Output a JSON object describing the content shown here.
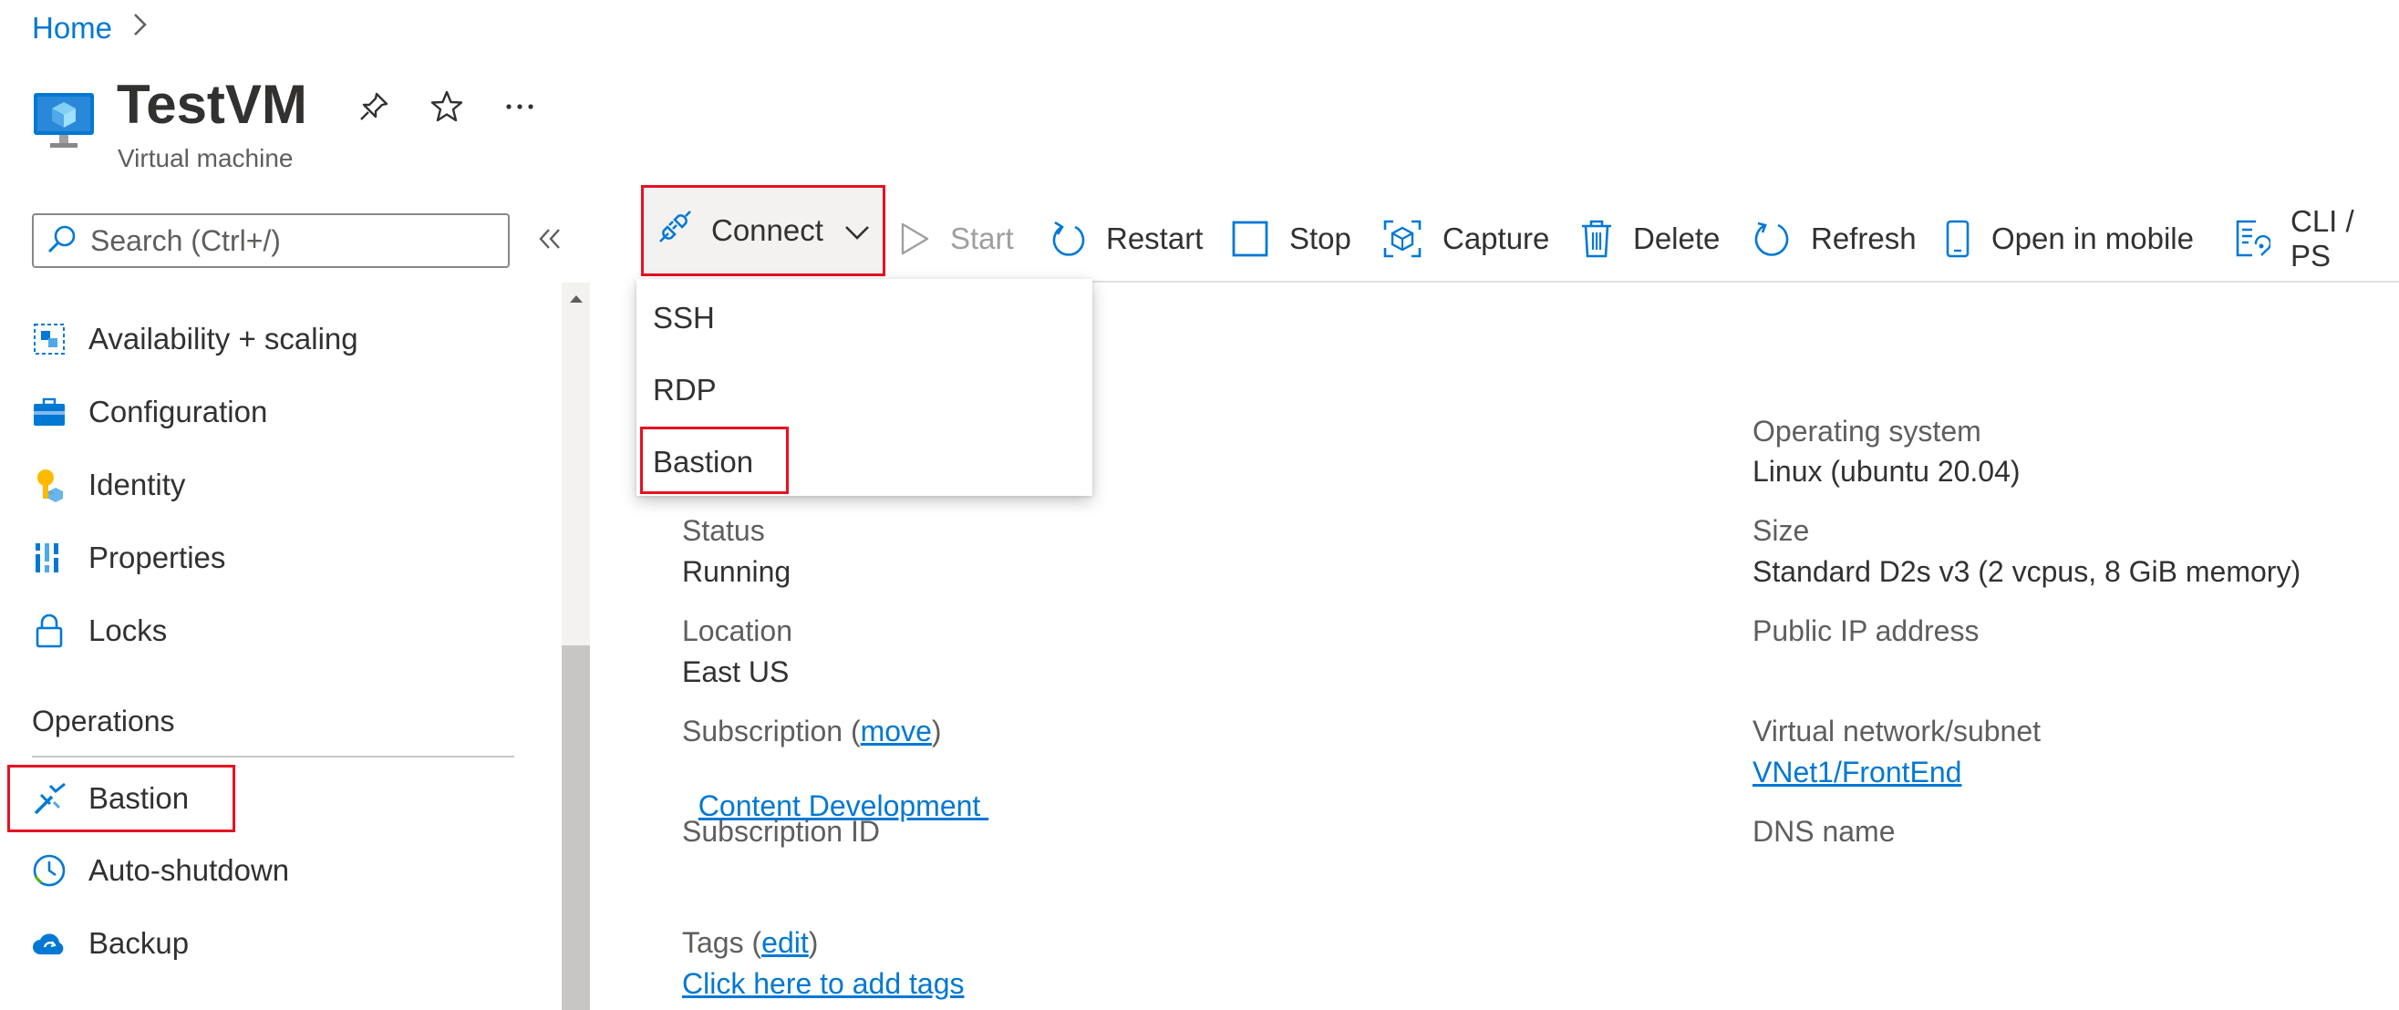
{
  "breadcrumb": {
    "home": "Home"
  },
  "header": {
    "title": "TestVM",
    "subtitle": "Virtual machine",
    "pin_icon": "pin-icon",
    "favorite_icon": "star-icon",
    "more_icon": "ellipsis-icon"
  },
  "search": {
    "placeholder": "Search (Ctrl+/)"
  },
  "sidebar": {
    "items": [
      {
        "label": "Availability + scaling",
        "icon": "availability-scaling-icon"
      },
      {
        "label": "Configuration",
        "icon": "configuration-icon"
      },
      {
        "label": "Identity",
        "icon": "identity-icon"
      },
      {
        "label": "Properties",
        "icon": "properties-icon"
      },
      {
        "label": "Locks",
        "icon": "lock-icon"
      }
    ],
    "section": "Operations",
    "ops_items": [
      {
        "label": "Bastion",
        "icon": "bastion-icon"
      },
      {
        "label": "Auto-shutdown",
        "icon": "clock-icon"
      },
      {
        "label": "Backup",
        "icon": "backup-cloud-icon"
      }
    ]
  },
  "toolbar": {
    "connect": "Connect",
    "start": "Start",
    "restart": "Restart",
    "stop": "Stop",
    "capture": "Capture",
    "delete": "Delete",
    "refresh": "Refresh",
    "open_mobile": "Open in mobile",
    "cli": "CLI / PS"
  },
  "connect_menu": [
    "SSH",
    "RDP",
    "Bastion"
  ],
  "essentials": {
    "left": {
      "status_label": "Status",
      "status_value": "Running",
      "location_label": "Location",
      "location_value": "East US",
      "subscription_label": "Subscription (",
      "subscription_move": "move",
      "subscription_close": ")",
      "subscription_value": "Content Development ",
      "subscription_id_label": "Subscription ID",
      "tags_label": "Tags (",
      "tags_edit": "edit",
      "tags_close": ")",
      "tags_value": "Click here to add tags"
    },
    "right": {
      "os_label": "Operating system",
      "os_value": "Linux (ubuntu 20.04)",
      "size_label": "Size",
      "size_value": "Standard D2s v3 (2 vcpus, 8 GiB memory)",
      "public_ip_label": "Public IP address",
      "vnet_label": "Virtual network/subnet",
      "vnet_value": "VNet1/FrontEnd",
      "dns_label": "DNS name"
    }
  },
  "colors": {
    "accent": "#0078d4",
    "highlight": "#e81123"
  }
}
